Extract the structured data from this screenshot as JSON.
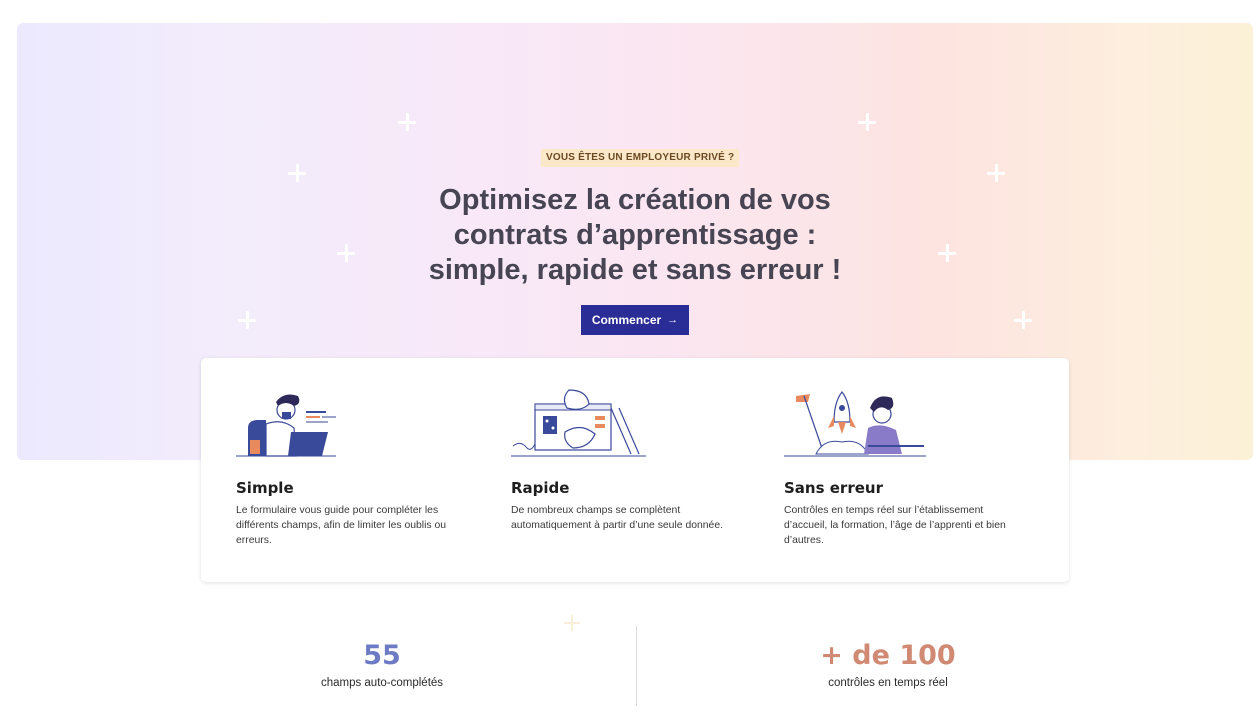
{
  "hero": {
    "eyebrow": "VOUS ÊTES UN EMPLOYEUR PRIVÉ ?",
    "title_line1": "Optimisez la création de vos",
    "title_line2": "contrats d’apprentissage :",
    "title_line3": "simple, rapide et sans erreur !",
    "cta_label": "Commencer",
    "cta_arrow": "→"
  },
  "features": [
    {
      "title": "Simple",
      "text": "Le formulaire vous guide pour compléter les différents champs, afin de limiter les oublis ou erreurs."
    },
    {
      "title": "Rapide",
      "text": "De nombreux champs se complètent automatiquement à partir d’une seule donnée."
    },
    {
      "title": "Sans erreur",
      "text": "Contrôles en temps réel sur l’établissement d’accueil, la formation, l’âge de l’apprenti et bien d’autres."
    }
  ],
  "stats": [
    {
      "value": "55",
      "label": "champs auto-complétés",
      "color": "#6d7bc4"
    },
    {
      "value": "+ de 100",
      "label": "contrôles en temps réel",
      "color": "#d08a74"
    }
  ],
  "colors": {
    "cta_bg": "#2b2d96",
    "eyebrow_bg": "#fbe8c8",
    "illustration_blue": "#3a4a9a",
    "illustration_orange": "#e8895e"
  }
}
